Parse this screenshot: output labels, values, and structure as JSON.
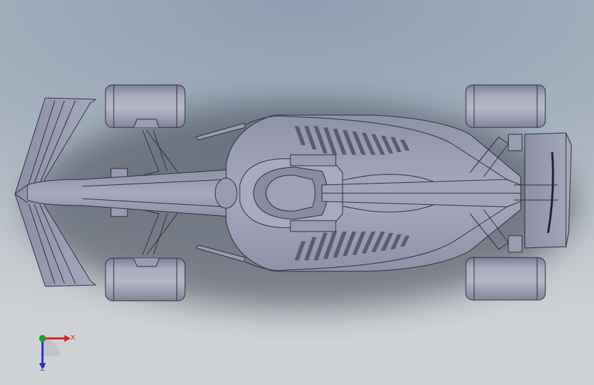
{
  "scene": {
    "model": "formula-car",
    "view": "top",
    "background_top": "#8e9db0",
    "background_bottom": "#cfd2d5",
    "body_color": "#9a9db1",
    "edge_color": "#2b2d38"
  },
  "triad": {
    "x_label": "X",
    "z_label": "Z",
    "x_color": "#d42020",
    "y_color": "#20a020",
    "z_color": "#2a2acc"
  }
}
